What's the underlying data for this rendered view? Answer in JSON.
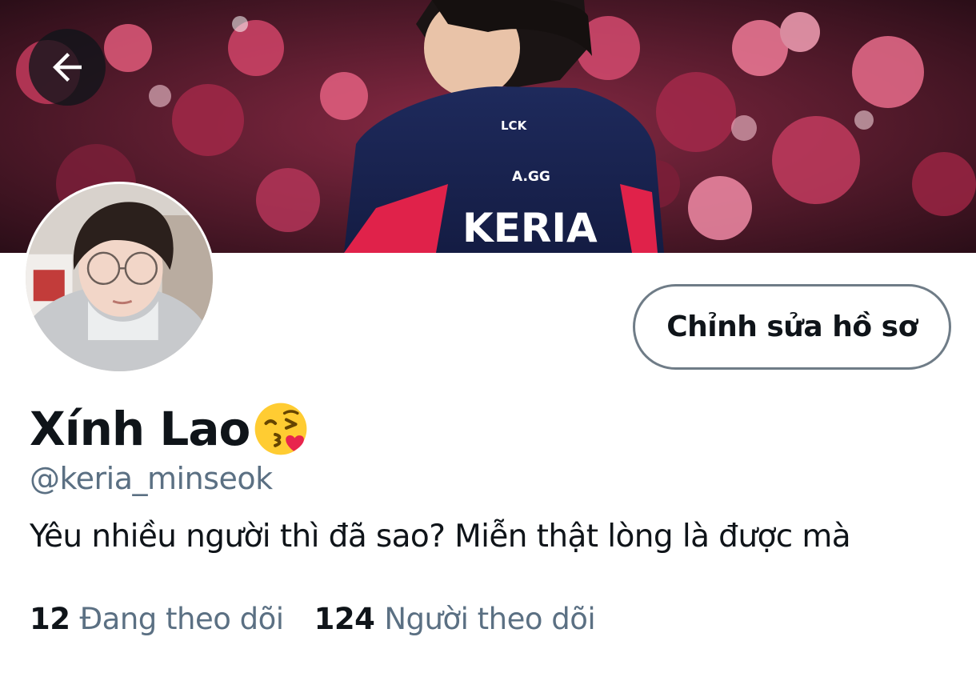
{
  "header": {
    "back_icon": "arrow-left-icon",
    "banner_jersey_text": "KERIA",
    "banner_sponsor_1": "LCK",
    "banner_sponsor_2": "A.GG"
  },
  "profile": {
    "display_name": "Xính Lao",
    "name_emoji": "face-blowing-kiss-icon",
    "handle": "@keria_minseok",
    "bio": "Yêu nhiều người thì đã sao? Miễn thật lòng là được mà",
    "edit_profile_label": "Chỉnh sửa hồ sơ"
  },
  "stats": {
    "following_count": "12",
    "following_label": "Đang theo dõi",
    "followers_count": "124",
    "followers_label": "Người theo dõi"
  },
  "colors": {
    "text_primary": "#0f1419",
    "text_secondary": "#5b7083",
    "button_border": "#6f7c87",
    "background": "#ffffff"
  }
}
